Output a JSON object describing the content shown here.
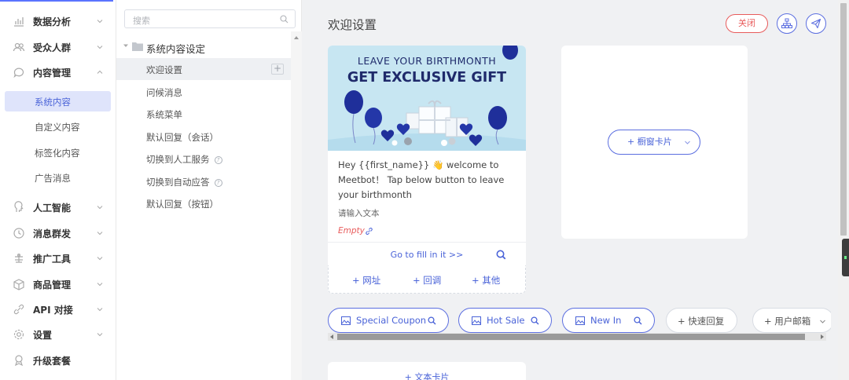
{
  "nav": {
    "items": [
      {
        "label": "数据分析",
        "icon": "chart-icon"
      },
      {
        "label": "受众人群",
        "icon": "users-icon"
      },
      {
        "label": "内容管理",
        "icon": "chat-icon",
        "expanded": true
      },
      {
        "label": "人工智能",
        "icon": "ai-icon"
      },
      {
        "label": "消息群发",
        "icon": "broadcast-icon"
      },
      {
        "label": "推广工具",
        "icon": "promo-icon"
      },
      {
        "label": "商品管理",
        "icon": "box-icon"
      },
      {
        "label": "API 对接",
        "icon": "api-icon"
      },
      {
        "label": "设置",
        "icon": "gear-icon"
      },
      {
        "label": "升级套餐",
        "icon": "upgrade-icon"
      }
    ],
    "sub_items": [
      "系统内容",
      "自定义内容",
      "标签化内容",
      "广告消息"
    ]
  },
  "tree": {
    "search_placeholder": "搜索",
    "root": "系统内容设定",
    "items": [
      "欢迎设置",
      "问候消息",
      "系统菜单",
      "默认回复（会话）",
      "切换到人工服务",
      "切换到自动应答",
      "默认回复（按钮）"
    ]
  },
  "main": {
    "title": "欢迎设置",
    "close_label": "关闭",
    "card": {
      "banner_line1": "LEAVE YOUR BIRTHMONTH",
      "banner_line2": "GET EXCLUSIVE GIFT",
      "text": "Hey {{first_name}} 👋 welcome to Meetbot！ Tap below button to leave your birthmonth",
      "input_placeholder": "请输入文本",
      "empty_label": "Empty",
      "fill_link": "Go to fill in it >>",
      "actions": [
        "+ 网址",
        "+ 回调",
        "+ 其他"
      ]
    },
    "slide_card_label": "+  橱窗卡片",
    "quick_replies": [
      "Special Coupon",
      "Hot Sale",
      "New In"
    ],
    "quick_reply_add": "+ 快速回复",
    "user_email": "+ 用户邮箱",
    "text_card": "+  文本卡片"
  },
  "colors": {
    "accent": "#4a63d8",
    "danger": "#e85b5b",
    "active_bg": "#dfe4fb",
    "banner_bg": "#c7e6f2"
  }
}
